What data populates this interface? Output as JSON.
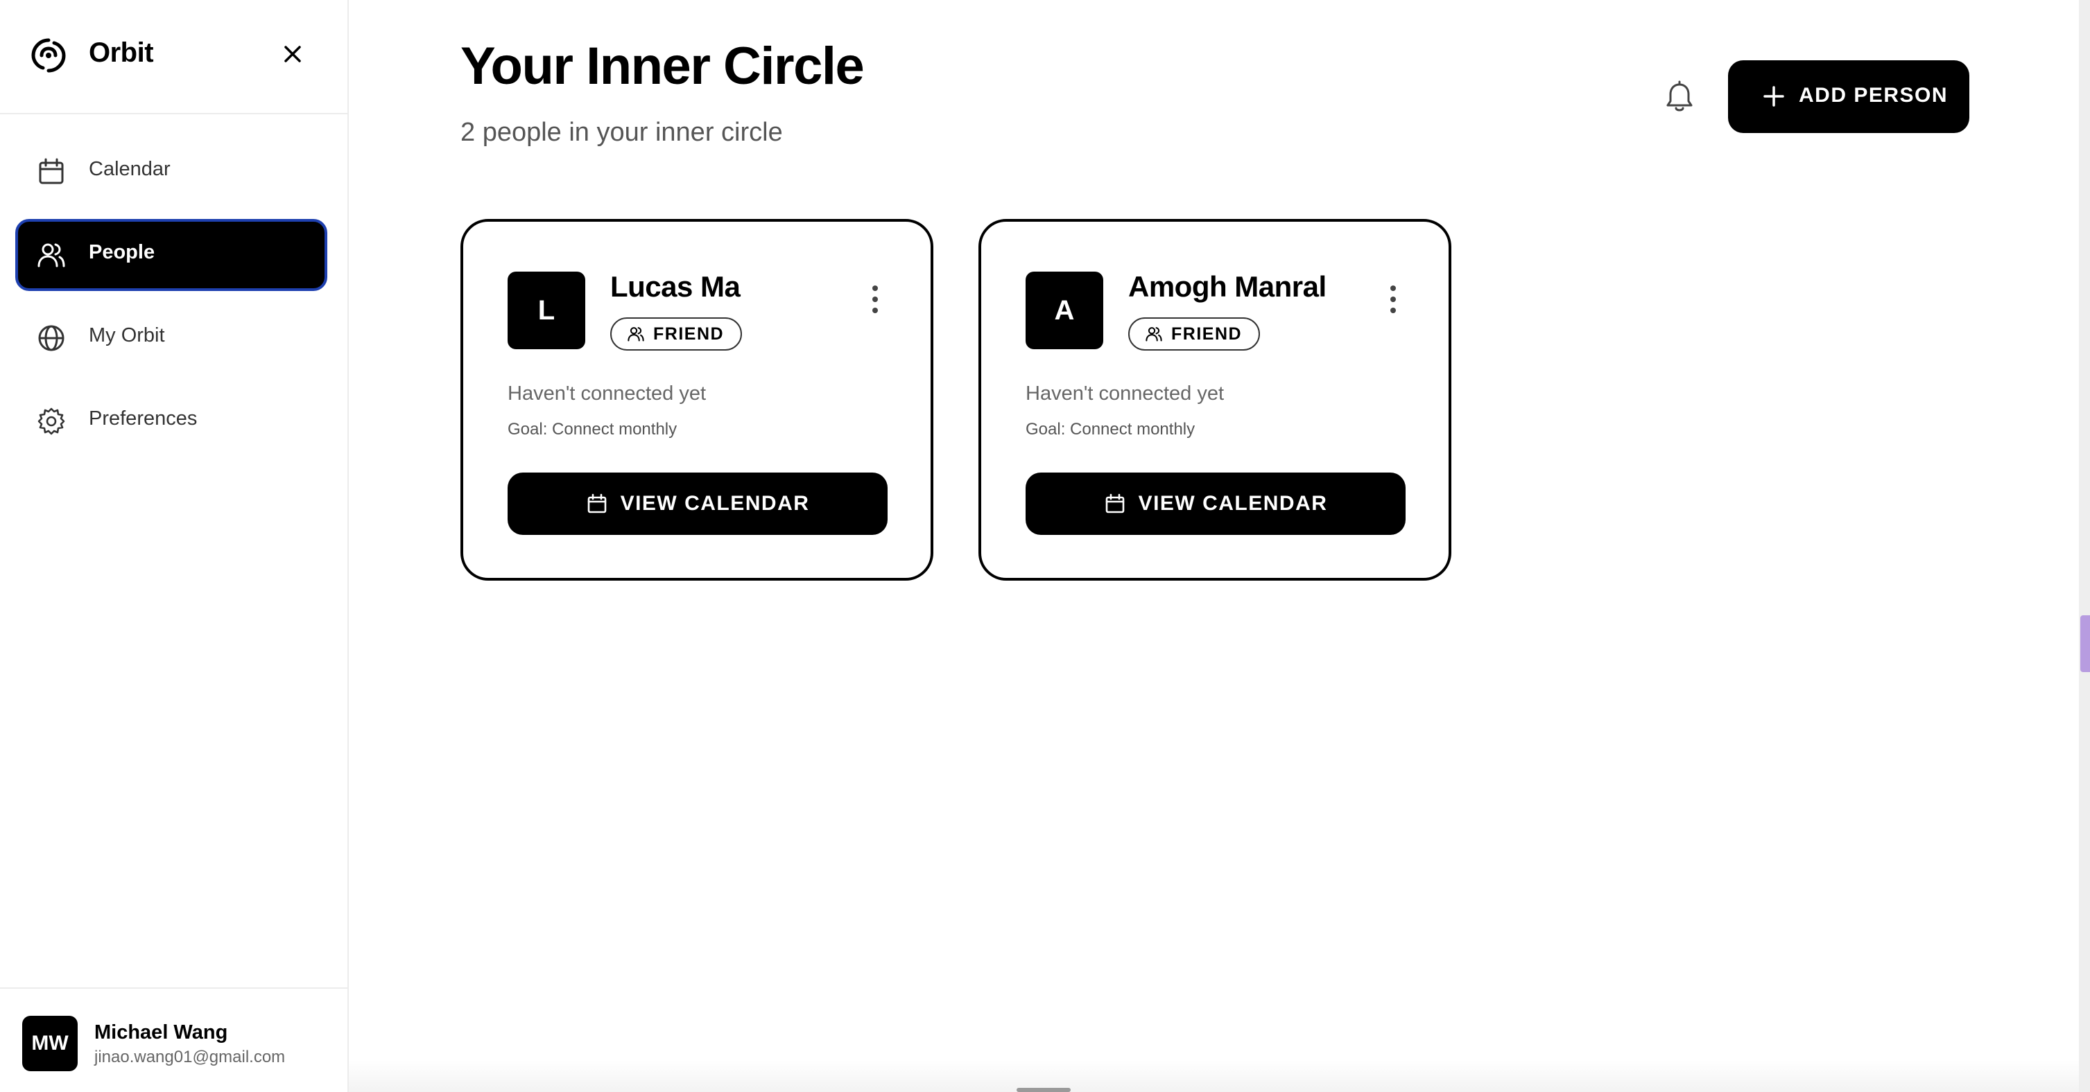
{
  "sidebar": {
    "brand": "Orbit",
    "items": [
      {
        "label": "Calendar",
        "icon": "calendar-icon",
        "active": false
      },
      {
        "label": "People",
        "icon": "people-icon",
        "active": true
      },
      {
        "label": "My Orbit",
        "icon": "globe-icon",
        "active": false
      },
      {
        "label": "Preferences",
        "icon": "gear-icon",
        "active": false
      }
    ],
    "user": {
      "initials": "MW",
      "name": "Michael Wang",
      "email": "jinao.wang01@gmail.com"
    }
  },
  "header": {
    "title": "Your Inner Circle",
    "subtitle": "2 people in your inner circle",
    "add_button_label": "ADD PERSON"
  },
  "people": [
    {
      "initial": "L",
      "name": "Lucas Ma",
      "badge": "FRIEND",
      "status": "Haven't connected yet",
      "goal": "Goal: Connect monthly",
      "button_label": "VIEW CALENDAR"
    },
    {
      "initial": "A",
      "name": "Amogh Manral",
      "badge": "FRIEND",
      "status": "Haven't connected yet",
      "goal": "Goal: Connect monthly",
      "button_label": "VIEW CALENDAR"
    }
  ],
  "colors": {
    "primary": "#000000",
    "active_outline": "#1e40af",
    "muted_text": "#666666",
    "edge_tab": "#b79ce0"
  }
}
